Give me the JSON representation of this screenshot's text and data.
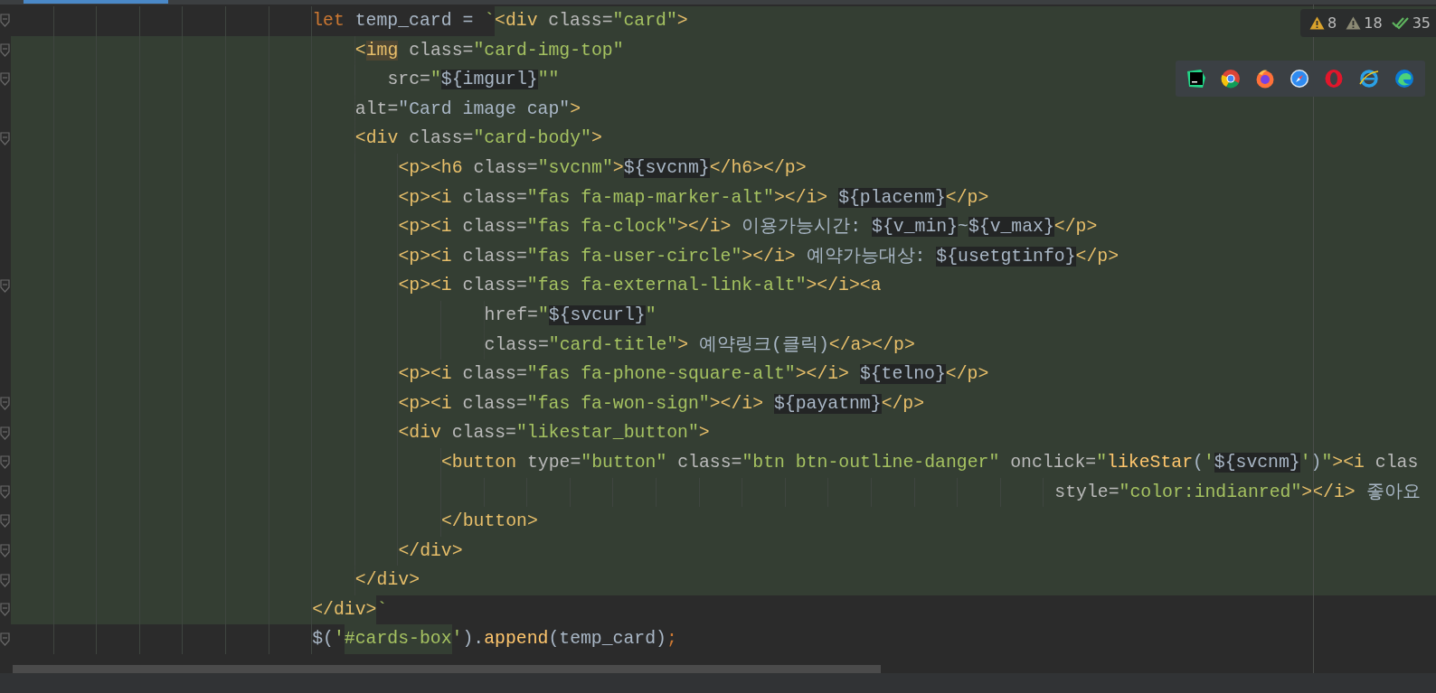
{
  "inspections": [
    {
      "kind": "warning",
      "count": "8"
    },
    {
      "kind": "weak",
      "count": "18"
    },
    {
      "kind": "typo",
      "count": "35"
    }
  ],
  "lines": [
    {
      "fold": true,
      "segments": [
        {
          "injected": false,
          "tokens": [
            {
              "kind": "k",
              "text": "                            let"
            },
            {
              "kind": "p",
              "text": " temp_card = "
            },
            {
              "kind": "s",
              "text": "`"
            }
          ]
        },
        {
          "injected": true,
          "tokens": [
            {
              "kind": "t",
              "text": "<div"
            },
            {
              "kind": "a",
              "text": " class="
            },
            {
              "kind": "s",
              "text": "\"card\""
            },
            {
              "kind": "t",
              "text": ">"
            }
          ]
        }
      ]
    },
    {
      "fold": true,
      "segments": [
        {
          "injected": true,
          "tokens": [
            {
              "kind": "t",
              "text": "                                <"
            },
            {
              "kind": "m",
              "text": "img"
            },
            {
              "kind": "a",
              "text": " class="
            },
            {
              "kind": "s",
              "text": "\"card-img-top\""
            }
          ]
        }
      ]
    },
    {
      "fold": true,
      "segments": [
        {
          "injected": true,
          "tokens": [
            {
              "kind": "a",
              "text": "                                   src="
            },
            {
              "kind": "s",
              "text": "\""
            },
            {
              "kind": "v",
              "text": "${imgurl}"
            },
            {
              "kind": "s",
              "text": "\"\""
            }
          ]
        }
      ]
    },
    {
      "fold": false,
      "segments": [
        {
          "injected": true,
          "tokens": [
            {
              "kind": "a",
              "text": "                                alt="
            },
            {
              "kind": "p",
              "text": "\"Card image cap\""
            },
            {
              "kind": "t",
              "text": ">"
            }
          ]
        }
      ]
    },
    {
      "fold": true,
      "segments": [
        {
          "injected": true,
          "tokens": [
            {
              "kind": "t",
              "text": "                                <div"
            },
            {
              "kind": "a",
              "text": " class="
            },
            {
              "kind": "s",
              "text": "\"card-body\""
            },
            {
              "kind": "t",
              "text": ">"
            }
          ]
        }
      ]
    },
    {
      "fold": false,
      "segments": [
        {
          "injected": true,
          "tokens": [
            {
              "kind": "t",
              "text": "                                    <p><h6"
            },
            {
              "kind": "a",
              "text": " class="
            },
            {
              "kind": "s",
              "text": "\"svcnm\""
            },
            {
              "kind": "t",
              "text": ">"
            },
            {
              "kind": "v",
              "text": "${svcnm}"
            },
            {
              "kind": "t",
              "text": "</h6></p>"
            }
          ]
        }
      ]
    },
    {
      "fold": false,
      "segments": [
        {
          "injected": true,
          "tokens": [
            {
              "kind": "t",
              "text": "                                    <p><i"
            },
            {
              "kind": "a",
              "text": " class="
            },
            {
              "kind": "s",
              "text": "\"fas fa-map-marker-alt\""
            },
            {
              "kind": "t",
              "text": "></i> "
            },
            {
              "kind": "v",
              "text": "${placenm}"
            },
            {
              "kind": "t",
              "text": "</p>"
            }
          ]
        }
      ]
    },
    {
      "fold": false,
      "segments": [
        {
          "injected": true,
          "tokens": [
            {
              "kind": "t",
              "text": "                                    <p><i"
            },
            {
              "kind": "a",
              "text": " class="
            },
            {
              "kind": "s",
              "text": "\"fas fa-clock\""
            },
            {
              "kind": "t",
              "text": "></i>"
            },
            {
              "kind": "p",
              "text": " 이용가능시간: "
            },
            {
              "kind": "v",
              "text": "${v_min}"
            },
            {
              "kind": "p",
              "text": "~"
            },
            {
              "kind": "v",
              "text": "${v_max}"
            },
            {
              "kind": "t",
              "text": "</p>"
            }
          ]
        }
      ]
    },
    {
      "fold": false,
      "segments": [
        {
          "injected": true,
          "tokens": [
            {
              "kind": "t",
              "text": "                                    <p><i"
            },
            {
              "kind": "a",
              "text": " class="
            },
            {
              "kind": "s",
              "text": "\"fas fa-user-circle\""
            },
            {
              "kind": "t",
              "text": "></i>"
            },
            {
              "kind": "p",
              "text": " 예약가능대상: "
            },
            {
              "kind": "v",
              "text": "${usetgtinfo}"
            },
            {
              "kind": "t",
              "text": "</p>"
            }
          ]
        }
      ]
    },
    {
      "fold": true,
      "segments": [
        {
          "injected": true,
          "tokens": [
            {
              "kind": "t",
              "text": "                                    <p><i"
            },
            {
              "kind": "a",
              "text": " class="
            },
            {
              "kind": "s",
              "text": "\"fas fa-external-link-alt\""
            },
            {
              "kind": "t",
              "text": "></i><a"
            }
          ]
        }
      ]
    },
    {
      "fold": false,
      "segments": [
        {
          "injected": true,
          "tokens": [
            {
              "kind": "a",
              "text": "                                            href="
            },
            {
              "kind": "s",
              "text": "\""
            },
            {
              "kind": "v",
              "text": "${svcurl}"
            },
            {
              "kind": "s",
              "text": "\""
            }
          ]
        }
      ]
    },
    {
      "fold": false,
      "segments": [
        {
          "injected": true,
          "tokens": [
            {
              "kind": "a",
              "text": "                                            class="
            },
            {
              "kind": "s",
              "text": "\"card-title\""
            },
            {
              "kind": "t",
              "text": ">"
            },
            {
              "kind": "p",
              "text": " 예약링크(클릭)"
            },
            {
              "kind": "t",
              "text": "</a></p>"
            }
          ]
        }
      ]
    },
    {
      "fold": false,
      "segments": [
        {
          "injected": true,
          "tokens": [
            {
              "kind": "t",
              "text": "                                    <p><i"
            },
            {
              "kind": "a",
              "text": " class="
            },
            {
              "kind": "s",
              "text": "\"fas fa-phone-square-alt\""
            },
            {
              "kind": "t",
              "text": "></i> "
            },
            {
              "kind": "v",
              "text": "${telno}"
            },
            {
              "kind": "t",
              "text": "</p>"
            }
          ]
        }
      ]
    },
    {
      "fold": true,
      "segments": [
        {
          "injected": true,
          "tokens": [
            {
              "kind": "t",
              "text": "                                    <p><i"
            },
            {
              "kind": "a",
              "text": " class="
            },
            {
              "kind": "s",
              "text": "\"fas fa-won-sign\""
            },
            {
              "kind": "t",
              "text": "></i> "
            },
            {
              "kind": "v",
              "text": "${payatnm}"
            },
            {
              "kind": "t",
              "text": "</p>"
            }
          ]
        }
      ]
    },
    {
      "fold": true,
      "segments": [
        {
          "injected": true,
          "tokens": [
            {
              "kind": "t",
              "text": "                                    <div"
            },
            {
              "kind": "a",
              "text": " class="
            },
            {
              "kind": "s",
              "text": "\"likestar_button\""
            },
            {
              "kind": "t",
              "text": ">"
            }
          ]
        }
      ]
    },
    {
      "fold": true,
      "segments": [
        {
          "injected": true,
          "tokens": [
            {
              "kind": "t",
              "text": "                                        <button"
            },
            {
              "kind": "a",
              "text": " type="
            },
            {
              "kind": "s",
              "text": "\"button\""
            },
            {
              "kind": "a",
              "text": " class="
            },
            {
              "kind": "s",
              "text": "\"btn btn-outline-danger\""
            },
            {
              "kind": "a",
              "text": " onclick="
            },
            {
              "kind": "s",
              "text": "\""
            },
            {
              "kind": "f",
              "text": "likeStar"
            },
            {
              "kind": "p",
              "text": "("
            },
            {
              "kind": "s",
              "text": "'"
            },
            {
              "kind": "v",
              "text": "${svcnm}"
            },
            {
              "kind": "s",
              "text": "'"
            },
            {
              "kind": "p",
              "text": ")"
            },
            {
              "kind": "s",
              "text": "\""
            },
            {
              "kind": "t",
              "text": "><i"
            },
            {
              "kind": "a",
              "text": " clas"
            }
          ]
        }
      ]
    },
    {
      "fold": true,
      "segments": [
        {
          "injected": true,
          "tokens": [
            {
              "kind": "a",
              "text": "                                                                                                 style="
            },
            {
              "kind": "s",
              "text": "\"color:indianred\""
            },
            {
              "kind": "t",
              "text": "></i>"
            },
            {
              "kind": "p",
              "text": " 좋아요"
            }
          ]
        }
      ]
    },
    {
      "fold": true,
      "segments": [
        {
          "injected": true,
          "tokens": [
            {
              "kind": "t",
              "text": "                                        </button>"
            }
          ]
        }
      ]
    },
    {
      "fold": true,
      "segments": [
        {
          "injected": true,
          "tokens": [
            {
              "kind": "t",
              "text": "                                    </div>"
            }
          ]
        }
      ]
    },
    {
      "fold": true,
      "segments": [
        {
          "injected": true,
          "tokens": [
            {
              "kind": "t",
              "text": "                                </div>"
            }
          ]
        }
      ]
    },
    {
      "fold": true,
      "segments": [
        {
          "injected": true,
          "tokens": [
            {
              "kind": "t",
              "text": "                            </div>"
            }
          ]
        },
        {
          "injected": false,
          "tokens": [
            {
              "kind": "s",
              "text": "`"
            }
          ]
        }
      ]
    },
    {
      "fold": true,
      "segments": [
        {
          "injected": false,
          "tokens": [
            {
              "kind": "p",
              "text": "                            $("
            },
            {
              "kind": "s",
              "text": "'"
            }
          ]
        },
        {
          "injected": true,
          "tokens": [
            {
              "kind": "s",
              "text": "#cards-box"
            }
          ]
        },
        {
          "injected": false,
          "tokens": [
            {
              "kind": "s",
              "text": "'"
            },
            {
              "kind": "p",
              "text": ")."
            },
            {
              "kind": "f",
              "text": "append"
            },
            {
              "kind": "p",
              "text": "(temp_card)"
            },
            {
              "kind": "k",
              "text": ";"
            }
          ]
        }
      ]
    }
  ]
}
